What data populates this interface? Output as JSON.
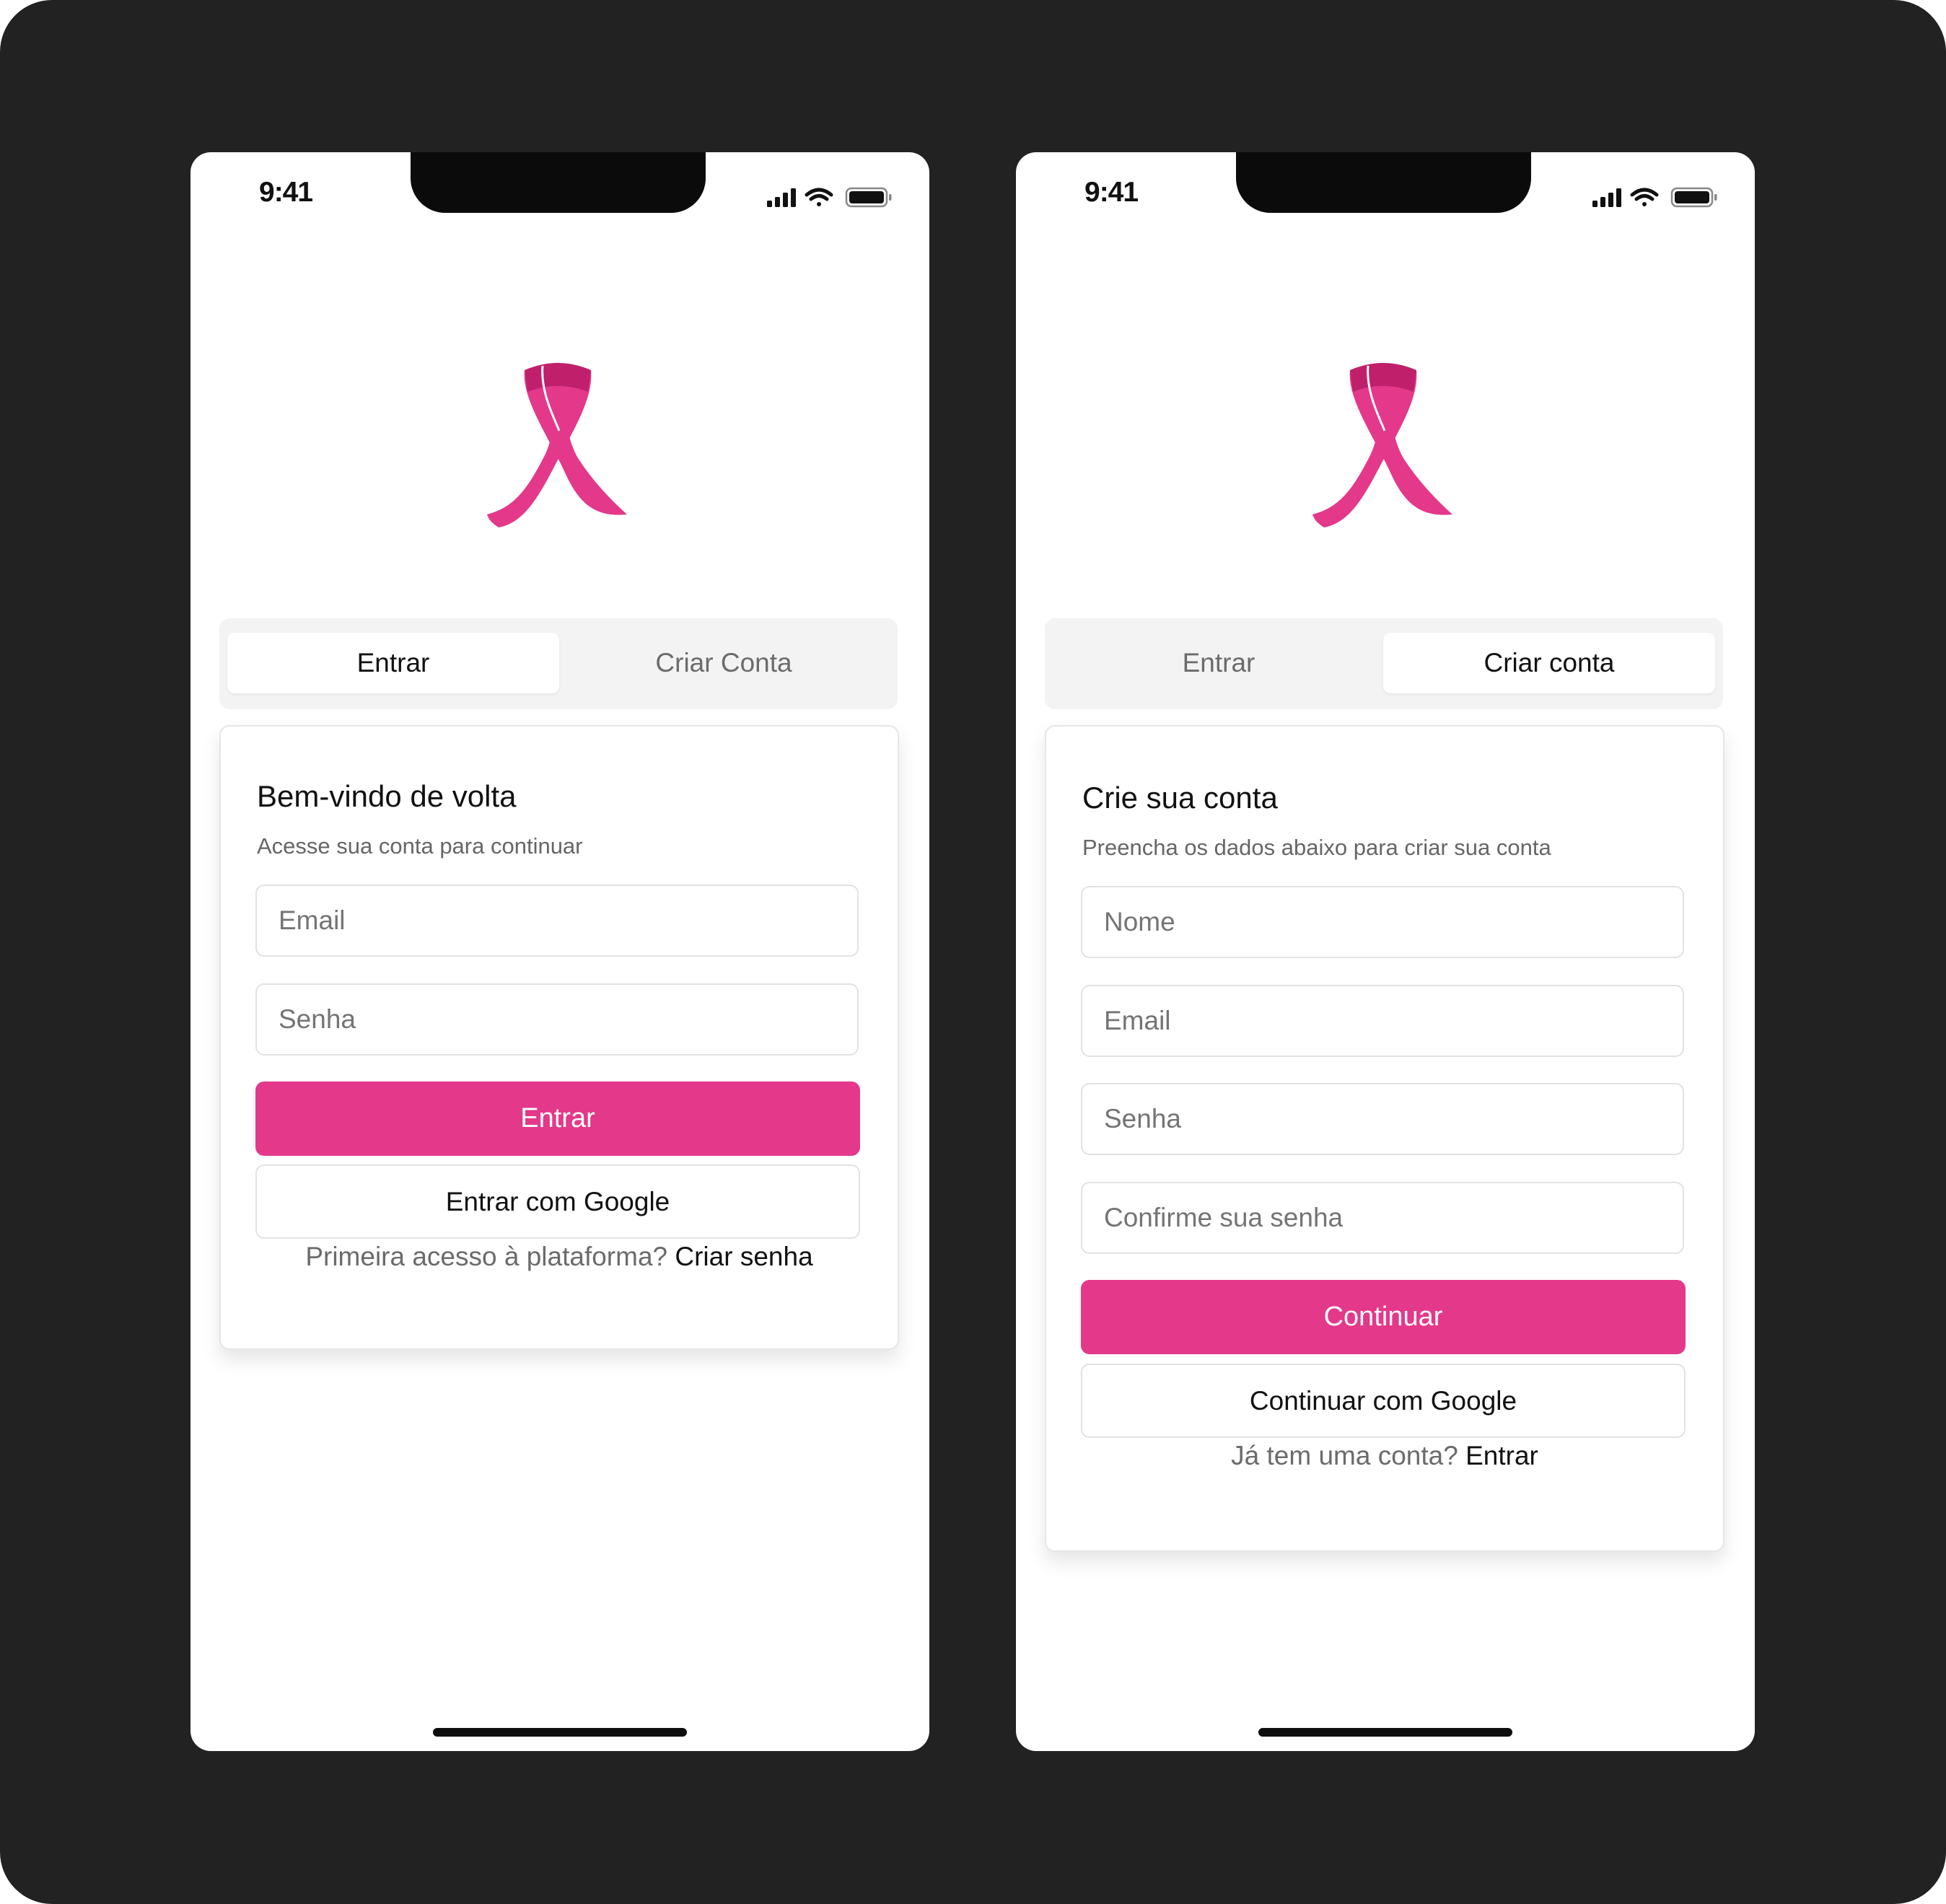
{
  "colors": {
    "background": "#222222",
    "accent": "#e4388a",
    "ribbon": "#e4388a",
    "ribbon_dark": "#c0206b"
  },
  "screens": [
    {
      "status": {
        "time": "9:41",
        "icons": [
          "signal-icon",
          "wifi-icon",
          "battery-icon"
        ]
      },
      "logo": "pink-ribbon-icon",
      "tabs": [
        {
          "label": "Entrar",
          "active": true
        },
        {
          "label": "Criar Conta",
          "active": false
        }
      ],
      "card": {
        "title": "Bem-vindo de volta",
        "subtitle": "Acesse sua conta para continuar",
        "fields": [
          {
            "placeholder": "Email"
          },
          {
            "placeholder": "Senha"
          }
        ],
        "primary_button": "Entrar",
        "secondary_button": "Entrar com Google",
        "footer_text": "Primeira acesso à plataforma?",
        "footer_link": "Criar senha"
      }
    },
    {
      "status": {
        "time": "9:41",
        "icons": [
          "signal-icon",
          "wifi-icon",
          "battery-icon"
        ]
      },
      "logo": "pink-ribbon-icon",
      "tabs": [
        {
          "label": "Entrar",
          "active": false
        },
        {
          "label": "Criar conta",
          "active": true
        }
      ],
      "card": {
        "title": "Crie sua conta",
        "subtitle": "Preencha os dados abaixo para criar sua conta",
        "fields": [
          {
            "placeholder": "Nome"
          },
          {
            "placeholder": "Email"
          },
          {
            "placeholder": "Senha"
          },
          {
            "placeholder": "Confirme sua senha"
          }
        ],
        "primary_button": "Continuar",
        "secondary_button": "Continuar com Google",
        "footer_text": "Já tem uma conta?",
        "footer_link": "Entrar"
      }
    }
  ]
}
